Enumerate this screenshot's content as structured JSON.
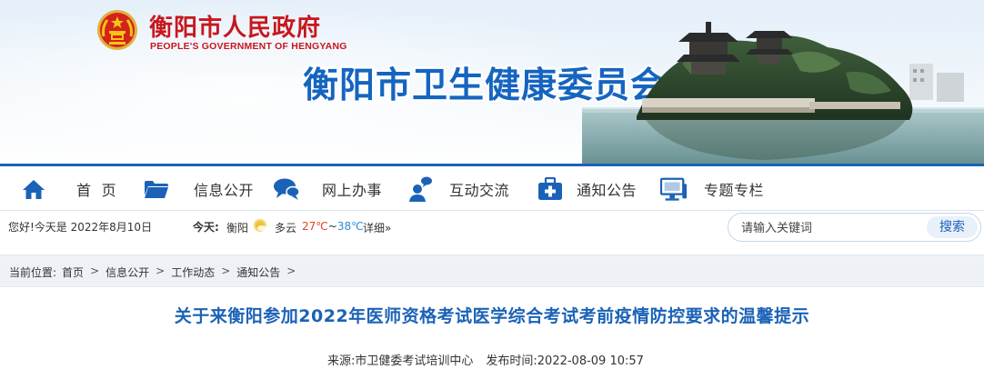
{
  "header": {
    "gov_name_cn": "衡阳市人民政府",
    "gov_name_en": "PEOPLE'S GOVERNMENT OF HENGYANG",
    "site_title": "衡阳市卫生健康委员会"
  },
  "nav": {
    "items": [
      {
        "label": "首  页",
        "icon": "home-icon"
      },
      {
        "label": "信息公开",
        "icon": "folder-icon"
      },
      {
        "label": "网上办事",
        "icon": "chat-icon"
      },
      {
        "label": "互动交流",
        "icon": "user-chat-icon"
      },
      {
        "label": "通知公告",
        "icon": "medical-kit-icon"
      },
      {
        "label": "专题专栏",
        "icon": "monitor-icon"
      }
    ]
  },
  "info": {
    "greeting": "您好!今天是 2022年8月10日",
    "weather_label": "今天:",
    "city": "衡阳",
    "condition": "多云",
    "temp_high": "27℃",
    "temp_sep": "~",
    "temp_low": "38℃",
    "detail_link": "详细»"
  },
  "search": {
    "placeholder": "请输入关键词",
    "button_label": "搜索"
  },
  "breadcrumb": {
    "prefix": "当前位置:",
    "items": [
      "首页",
      "信息公开",
      "工作动态",
      "通知公告"
    ],
    "separator": ">"
  },
  "article": {
    "title": "关于来衡阳参加2022年医师资格考试医学综合考试考前疫情防控要求的温馨提示",
    "source": "来源:市卫健委考试培训中心",
    "published": "发布时间:2022-08-09 10:57"
  },
  "colors": {
    "brand_blue": "#1b62b7",
    "gov_red": "#c8161d",
    "temp_high": "#e8401c",
    "temp_low": "#2b8cd8"
  }
}
